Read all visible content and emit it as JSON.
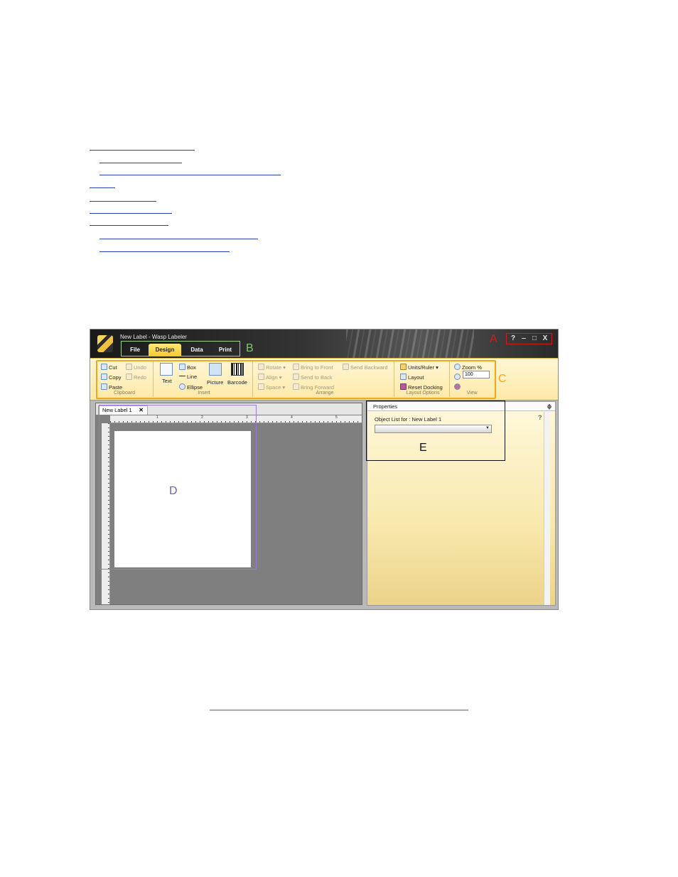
{
  "window": {
    "title": "New Label - Wasp Labeler",
    "menu_tabs": [
      "File",
      "Design",
      "Data",
      "Print"
    ],
    "active_tab": "Design",
    "controls": {
      "help": "?",
      "minimize": "‒",
      "maximize": "□",
      "close": "X"
    }
  },
  "callouts": {
    "a": "A",
    "b": "B",
    "c": "C",
    "d": "D",
    "e": "E"
  },
  "ribbon": {
    "clipboard": {
      "cut": "Cut",
      "copy": "Copy",
      "paste": "Paste",
      "undo": "Undo",
      "redo": "Redo",
      "label": "Clipboard"
    },
    "insert": {
      "box": "Box",
      "line": "Line",
      "ellipse": "Ellipse",
      "text": "Text",
      "picture": "Picture",
      "barcode": "Barcode",
      "label": "Insert"
    },
    "arrange": {
      "rotate": "Rotate",
      "align": "Align",
      "space": "Space",
      "bring_to_front": "Bring to Front",
      "send_to_back": "Send to Back",
      "bring_forward": "Bring Forward",
      "send_backward": "Send Backward",
      "label": "Arrange"
    },
    "layout_options": {
      "units_ruler": "Units/Ruler",
      "layout": "Layout",
      "reset_docking": "Reset Docking",
      "label": "Layout Options"
    },
    "view": {
      "zoom_percent": "Zoom %",
      "zoom_value": "100",
      "label": "View"
    }
  },
  "editor": {
    "doc_tab": "New Label 1",
    "ruler_numbers": [
      "1",
      "2",
      "3",
      "4",
      "5"
    ]
  },
  "properties": {
    "header": "Properties",
    "object_list_label": "Object List for :  New Label 1",
    "help": "?"
  },
  "colors": {
    "callout_a": "#d31c1c",
    "callout_b": "#7fc56e",
    "callout_c": "#f2a81d",
    "callout_d": "#7a5bb8",
    "toc_link": "#2a3fb0"
  }
}
